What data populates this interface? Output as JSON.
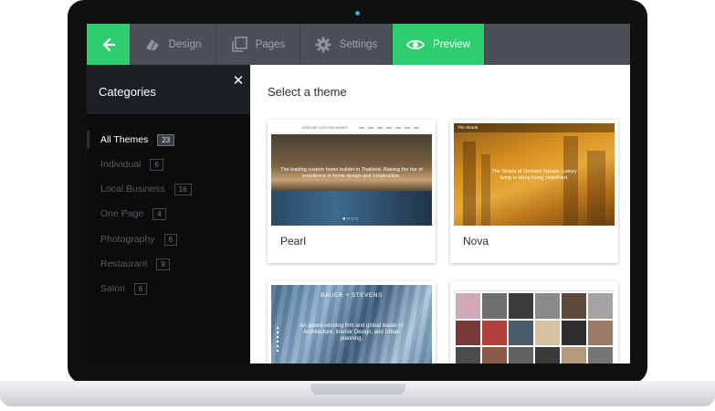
{
  "toolbar": {
    "back_icon": "arrow-left-icon",
    "tabs": [
      {
        "label": "Design",
        "icon": "design-icon"
      },
      {
        "label": "Pages",
        "icon": "pages-icon"
      },
      {
        "label": "Settings",
        "icon": "gear-icon"
      },
      {
        "label": "Preview",
        "icon": "eye-icon"
      }
    ],
    "colors": {
      "accent": "#2dce6e",
      "bar": "#4b5057"
    }
  },
  "sidebar": {
    "title": "Categories",
    "close_icon": "close-icon",
    "categories": [
      {
        "label": "All Themes",
        "count": "23",
        "active": true
      },
      {
        "label": "Individual",
        "count": "6"
      },
      {
        "label": "Local Business",
        "count": "16"
      },
      {
        "label": "One Page",
        "count": "4"
      },
      {
        "label": "Photography",
        "count": "6"
      },
      {
        "label": "Restaurant",
        "count": "9"
      },
      {
        "label": "Salon",
        "count": "6"
      }
    ]
  },
  "main": {
    "title": "Select a theme",
    "themes": [
      {
        "name": "Pearl",
        "preview": {
          "header": "ATADAR CUSTOM HOMES",
          "text": "The leading custom home builder in Thailand. Raising the bar of excellence in home design and construction."
        }
      },
      {
        "name": "Nova",
        "preview": {
          "header": "The Strada",
          "text": "The Strada at Orchard Square. Luxury living in Hong Kong, redefined."
        }
      },
      {
        "name": "",
        "preview": {
          "header": "BAUER + STEVENS",
          "text": "An award-winning firm and global leader in Architecture, Interior Design, and Urban planning."
        }
      },
      {
        "name": "",
        "preview": {
          "header": "",
          "text": ""
        }
      }
    ]
  }
}
